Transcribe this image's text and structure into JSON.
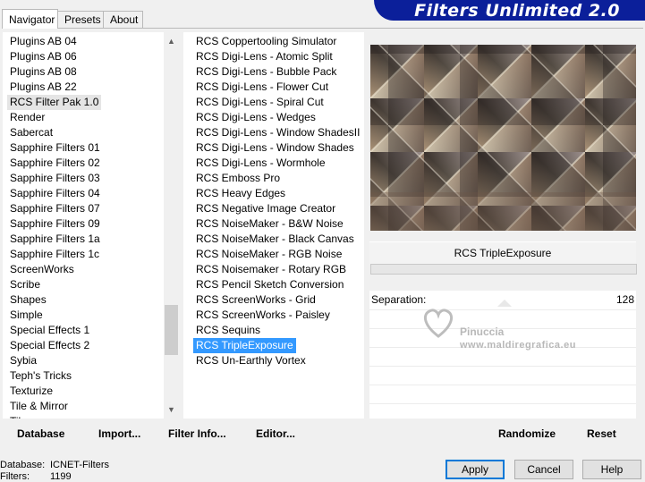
{
  "tabs": [
    {
      "label": "Navigator"
    },
    {
      "label": "Presets"
    },
    {
      "label": "About"
    }
  ],
  "banner_title": "Filters Unlimited 2.0",
  "categories": [
    "Plugins AB 04",
    "Plugins AB 06",
    "Plugins AB 08",
    "Plugins AB 22",
    "RCS Filter Pak 1.0",
    "Render",
    "Sabercat",
    "Sapphire Filters 01",
    "Sapphire Filters 02",
    "Sapphire Filters 03",
    "Sapphire Filters 04",
    "Sapphire Filters 07",
    "Sapphire Filters 09",
    "Sapphire Filters 1a",
    "Sapphire Filters 1c",
    "ScreenWorks",
    "Scribe",
    "Shapes",
    "Simple",
    "Special Effects 1",
    "Special Effects 2",
    "Sybia",
    "Teph's Tricks",
    "Texturize",
    "Tile & Mirror",
    "Tiles"
  ],
  "selected_category": "RCS Filter Pak 1.0",
  "filters": [
    "RCS Coppertooling Simulator",
    "RCS Digi-Lens - Atomic Split",
    "RCS Digi-Lens - Bubble Pack",
    "RCS Digi-Lens - Flower Cut",
    "RCS Digi-Lens - Spiral Cut",
    "RCS Digi-Lens - Wedges",
    "RCS Digi-Lens - Window ShadesII",
    "RCS Digi-Lens - Window Shades",
    "RCS Digi-Lens - Wormhole",
    "RCS Emboss Pro",
    "RCS Heavy Edges",
    "RCS Negative Image Creator",
    "RCS NoiseMaker - B&W Noise",
    "RCS NoiseMaker - Black Canvas",
    "RCS NoiseMaker - RGB Noise",
    "RCS Noisemaker - Rotary RGB",
    "RCS Pencil Sketch Conversion",
    "RCS ScreenWorks - Grid",
    "RCS ScreenWorks - Paisley",
    "RCS Sequins",
    "RCS TripleExposure",
    "RCS Un-Earthly Vortex"
  ],
  "selected_filter": "RCS TripleExposure",
  "filter_name": "RCS TripleExposure",
  "parameter": {
    "label": "Separation:",
    "value": "128"
  },
  "bottom_buttons": {
    "database": "Database",
    "import": "Import...",
    "filter_info": "Filter Info...",
    "editor": "Editor...",
    "randomize": "Randomize",
    "reset": "Reset"
  },
  "status": {
    "database_label": "Database:",
    "database_value": "ICNET-Filters",
    "filters_label": "Filters:",
    "filters_value": "1199"
  },
  "dialog_buttons": {
    "apply": "Apply",
    "cancel": "Cancel",
    "help": "Help"
  },
  "watermark": {
    "name": "Pinuccia",
    "site": "www.maldiregrafica.eu"
  },
  "colors": {
    "banner": "#0b1f9a",
    "highlight": "#3399ff",
    "default_button_border": "#0078d7"
  }
}
